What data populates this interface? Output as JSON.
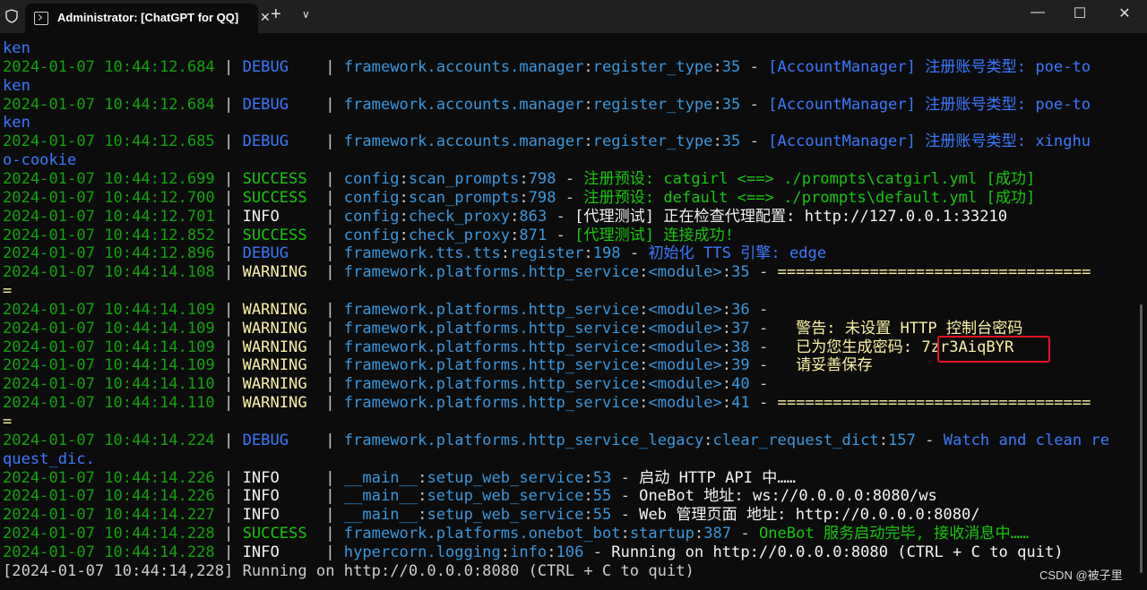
{
  "window": {
    "tab_title": "Administrator:  [ChatGPT for QQ]",
    "tab_close": "✕",
    "new_tab": "+",
    "dropdown": "∨",
    "minimize": "—",
    "maximize": "☐",
    "close": "✕"
  },
  "colors": {
    "background": "#0c0c0c",
    "timestamp_green": "#13a10e",
    "debug_blue": "#3b78ff",
    "module_cyan": "#3a96dd",
    "warning_yellow": "#f9f1a5",
    "success_green": "#16c60c",
    "highlight_box": "#e81123"
  },
  "lines": [
    [
      {
        "t": "ken",
        "c": "c-blue"
      }
    ],
    [
      {
        "t": "2024-01-07 10:44:12.684",
        "c": "c-green"
      },
      {
        "t": " | ",
        "c": "c-white"
      },
      {
        "t": "DEBUG   ",
        "c": "c-blue"
      },
      {
        "t": " | ",
        "c": "c-white"
      },
      {
        "t": "framework.accounts.manager",
        "c": "c-cyan"
      },
      {
        "t": ":",
        "c": "c-white"
      },
      {
        "t": "register_type",
        "c": "c-cyan"
      },
      {
        "t": ":",
        "c": "c-white"
      },
      {
        "t": "35",
        "c": "c-cyan"
      },
      {
        "t": " - ",
        "c": "c-white"
      },
      {
        "t": "[AccountManager] 注册账号类型: poe-to",
        "c": "c-blue"
      }
    ],
    [
      {
        "t": "ken",
        "c": "c-blue"
      }
    ],
    [
      {
        "t": "2024-01-07 10:44:12.684",
        "c": "c-green"
      },
      {
        "t": " | ",
        "c": "c-white"
      },
      {
        "t": "DEBUG   ",
        "c": "c-blue"
      },
      {
        "t": " | ",
        "c": "c-white"
      },
      {
        "t": "framework.accounts.manager",
        "c": "c-cyan"
      },
      {
        "t": ":",
        "c": "c-white"
      },
      {
        "t": "register_type",
        "c": "c-cyan"
      },
      {
        "t": ":",
        "c": "c-white"
      },
      {
        "t": "35",
        "c": "c-cyan"
      },
      {
        "t": " - ",
        "c": "c-white"
      },
      {
        "t": "[AccountManager] 注册账号类型: poe-to",
        "c": "c-blue"
      }
    ],
    [
      {
        "t": "ken",
        "c": "c-blue"
      }
    ],
    [
      {
        "t": "2024-01-07 10:44:12.685",
        "c": "c-green"
      },
      {
        "t": " | ",
        "c": "c-white"
      },
      {
        "t": "DEBUG   ",
        "c": "c-blue"
      },
      {
        "t": " | ",
        "c": "c-white"
      },
      {
        "t": "framework.accounts.manager",
        "c": "c-cyan"
      },
      {
        "t": ":",
        "c": "c-white"
      },
      {
        "t": "register_type",
        "c": "c-cyan"
      },
      {
        "t": ":",
        "c": "c-white"
      },
      {
        "t": "35",
        "c": "c-cyan"
      },
      {
        "t": " - ",
        "c": "c-white"
      },
      {
        "t": "[AccountManager] 注册账号类型: xinghu",
        "c": "c-blue"
      }
    ],
    [
      {
        "t": "o-cookie",
        "c": "c-blue"
      }
    ],
    [
      {
        "t": "2024-01-07 10:44:12.699",
        "c": "c-green"
      },
      {
        "t": " | ",
        "c": "c-white"
      },
      {
        "t": "SUCCESS ",
        "c": "c-lgreen"
      },
      {
        "t": " | ",
        "c": "c-white"
      },
      {
        "t": "config",
        "c": "c-cyan"
      },
      {
        "t": ":",
        "c": "c-white"
      },
      {
        "t": "scan_prompts",
        "c": "c-cyan"
      },
      {
        "t": ":",
        "c": "c-white"
      },
      {
        "t": "798",
        "c": "c-cyan"
      },
      {
        "t": " - ",
        "c": "c-white"
      },
      {
        "t": "注册预设: catgirl <==> ./prompts\\catgirl.yml [成功]",
        "c": "c-lgreen"
      }
    ],
    [
      {
        "t": "2024-01-07 10:44:12.700",
        "c": "c-green"
      },
      {
        "t": " | ",
        "c": "c-white"
      },
      {
        "t": "SUCCESS ",
        "c": "c-lgreen"
      },
      {
        "t": " | ",
        "c": "c-white"
      },
      {
        "t": "config",
        "c": "c-cyan"
      },
      {
        "t": ":",
        "c": "c-white"
      },
      {
        "t": "scan_prompts",
        "c": "c-cyan"
      },
      {
        "t": ":",
        "c": "c-white"
      },
      {
        "t": "798",
        "c": "c-cyan"
      },
      {
        "t": " - ",
        "c": "c-white"
      },
      {
        "t": "注册预设: default <==> ./prompts\\default.yml [成功]",
        "c": "c-lgreen"
      }
    ],
    [
      {
        "t": "2024-01-07 10:44:12.701",
        "c": "c-green"
      },
      {
        "t": " | ",
        "c": "c-white"
      },
      {
        "t": "INFO    ",
        "c": "c-brightwhite"
      },
      {
        "t": " | ",
        "c": "c-white"
      },
      {
        "t": "config",
        "c": "c-cyan"
      },
      {
        "t": ":",
        "c": "c-white"
      },
      {
        "t": "check_proxy",
        "c": "c-cyan"
      },
      {
        "t": ":",
        "c": "c-white"
      },
      {
        "t": "863",
        "c": "c-cyan"
      },
      {
        "t": " - ",
        "c": "c-white"
      },
      {
        "t": "[代理测试] 正在检查代理配置: http://127.0.0.1:33210",
        "c": "c-brightwhite"
      }
    ],
    [
      {
        "t": "2024-01-07 10:44:12.852",
        "c": "c-green"
      },
      {
        "t": " | ",
        "c": "c-white"
      },
      {
        "t": "SUCCESS ",
        "c": "c-lgreen"
      },
      {
        "t": " | ",
        "c": "c-white"
      },
      {
        "t": "config",
        "c": "c-cyan"
      },
      {
        "t": ":",
        "c": "c-white"
      },
      {
        "t": "check_proxy",
        "c": "c-cyan"
      },
      {
        "t": ":",
        "c": "c-white"
      },
      {
        "t": "871",
        "c": "c-cyan"
      },
      {
        "t": " - ",
        "c": "c-white"
      },
      {
        "t": "[代理测试] 连接成功!",
        "c": "c-lgreen"
      }
    ],
    [
      {
        "t": "2024-01-07 10:44:12.896",
        "c": "c-green"
      },
      {
        "t": " | ",
        "c": "c-white"
      },
      {
        "t": "DEBUG   ",
        "c": "c-blue"
      },
      {
        "t": " | ",
        "c": "c-white"
      },
      {
        "t": "framework.tts.tts",
        "c": "c-cyan"
      },
      {
        "t": ":",
        "c": "c-white"
      },
      {
        "t": "register",
        "c": "c-cyan"
      },
      {
        "t": ":",
        "c": "c-white"
      },
      {
        "t": "198",
        "c": "c-cyan"
      },
      {
        "t": " - ",
        "c": "c-white"
      },
      {
        "t": "初始化 TTS 引擎: edge",
        "c": "c-blue"
      }
    ],
    [
      {
        "t": "2024-01-07 10:44:14.108",
        "c": "c-green"
      },
      {
        "t": " | ",
        "c": "c-white"
      },
      {
        "t": "WARNING ",
        "c": "c-yellow"
      },
      {
        "t": " | ",
        "c": "c-white"
      },
      {
        "t": "framework.platforms.http_service",
        "c": "c-cyan"
      },
      {
        "t": ":",
        "c": "c-white"
      },
      {
        "t": "<module>",
        "c": "c-cyan"
      },
      {
        "t": ":",
        "c": "c-white"
      },
      {
        "t": "35",
        "c": "c-cyan"
      },
      {
        "t": " - ",
        "c": "c-white"
      },
      {
        "t": "==================================",
        "c": "c-yellow"
      }
    ],
    [
      {
        "t": "=",
        "c": "c-yellow"
      }
    ],
    [
      {
        "t": "2024-01-07 10:44:14.109",
        "c": "c-green"
      },
      {
        "t": " | ",
        "c": "c-white"
      },
      {
        "t": "WARNING ",
        "c": "c-yellow"
      },
      {
        "t": " | ",
        "c": "c-white"
      },
      {
        "t": "framework.platforms.http_service",
        "c": "c-cyan"
      },
      {
        "t": ":",
        "c": "c-white"
      },
      {
        "t": "<module>",
        "c": "c-cyan"
      },
      {
        "t": ":",
        "c": "c-white"
      },
      {
        "t": "36",
        "c": "c-cyan"
      },
      {
        "t": " - ",
        "c": "c-white"
      }
    ],
    [
      {
        "t": "2024-01-07 10:44:14.109",
        "c": "c-green"
      },
      {
        "t": " | ",
        "c": "c-white"
      },
      {
        "t": "WARNING ",
        "c": "c-yellow"
      },
      {
        "t": " | ",
        "c": "c-white"
      },
      {
        "t": "framework.platforms.http_service",
        "c": "c-cyan"
      },
      {
        "t": ":",
        "c": "c-white"
      },
      {
        "t": "<module>",
        "c": "c-cyan"
      },
      {
        "t": ":",
        "c": "c-white"
      },
      {
        "t": "37",
        "c": "c-cyan"
      },
      {
        "t": " - ",
        "c": "c-white"
      },
      {
        "t": "  警告: 未设置 HTTP 控制台密码",
        "c": "c-yellow"
      }
    ],
    [
      {
        "t": "2024-01-07 10:44:14.109",
        "c": "c-green"
      },
      {
        "t": " | ",
        "c": "c-white"
      },
      {
        "t": "WARNING ",
        "c": "c-yellow"
      },
      {
        "t": " | ",
        "c": "c-white"
      },
      {
        "t": "framework.platforms.http_service",
        "c": "c-cyan"
      },
      {
        "t": ":",
        "c": "c-white"
      },
      {
        "t": "<module>",
        "c": "c-cyan"
      },
      {
        "t": ":",
        "c": "c-white"
      },
      {
        "t": "38",
        "c": "c-cyan"
      },
      {
        "t": " - ",
        "c": "c-white"
      },
      {
        "t": "  已为您生成密码: 7zr3AiqBYR",
        "c": "c-yellow"
      }
    ],
    [
      {
        "t": "2024-01-07 10:44:14.109",
        "c": "c-green"
      },
      {
        "t": " | ",
        "c": "c-white"
      },
      {
        "t": "WARNING ",
        "c": "c-yellow"
      },
      {
        "t": " | ",
        "c": "c-white"
      },
      {
        "t": "framework.platforms.http_service",
        "c": "c-cyan"
      },
      {
        "t": ":",
        "c": "c-white"
      },
      {
        "t": "<module>",
        "c": "c-cyan"
      },
      {
        "t": ":",
        "c": "c-white"
      },
      {
        "t": "39",
        "c": "c-cyan"
      },
      {
        "t": " - ",
        "c": "c-white"
      },
      {
        "t": "  请妥善保存",
        "c": "c-yellow"
      }
    ],
    [
      {
        "t": "2024-01-07 10:44:14.110",
        "c": "c-green"
      },
      {
        "t": " | ",
        "c": "c-white"
      },
      {
        "t": "WARNING ",
        "c": "c-yellow"
      },
      {
        "t": " | ",
        "c": "c-white"
      },
      {
        "t": "framework.platforms.http_service",
        "c": "c-cyan"
      },
      {
        "t": ":",
        "c": "c-white"
      },
      {
        "t": "<module>",
        "c": "c-cyan"
      },
      {
        "t": ":",
        "c": "c-white"
      },
      {
        "t": "40",
        "c": "c-cyan"
      },
      {
        "t": " - ",
        "c": "c-white"
      }
    ],
    [
      {
        "t": "2024-01-07 10:44:14.110",
        "c": "c-green"
      },
      {
        "t": " | ",
        "c": "c-white"
      },
      {
        "t": "WARNING ",
        "c": "c-yellow"
      },
      {
        "t": " | ",
        "c": "c-white"
      },
      {
        "t": "framework.platforms.http_service",
        "c": "c-cyan"
      },
      {
        "t": ":",
        "c": "c-white"
      },
      {
        "t": "<module>",
        "c": "c-cyan"
      },
      {
        "t": ":",
        "c": "c-white"
      },
      {
        "t": "41",
        "c": "c-cyan"
      },
      {
        "t": " - ",
        "c": "c-white"
      },
      {
        "t": "==================================",
        "c": "c-yellow"
      }
    ],
    [
      {
        "t": "=",
        "c": "c-yellow"
      }
    ],
    [
      {
        "t": "2024-01-07 10:44:14.224",
        "c": "c-green"
      },
      {
        "t": " | ",
        "c": "c-white"
      },
      {
        "t": "DEBUG   ",
        "c": "c-blue"
      },
      {
        "t": " | ",
        "c": "c-white"
      },
      {
        "t": "framework.platforms.http_service_legacy",
        "c": "c-cyan"
      },
      {
        "t": ":",
        "c": "c-white"
      },
      {
        "t": "clear_request_dict",
        "c": "c-cyan"
      },
      {
        "t": ":",
        "c": "c-white"
      },
      {
        "t": "157",
        "c": "c-cyan"
      },
      {
        "t": " - ",
        "c": "c-white"
      },
      {
        "t": "Watch and clean re",
        "c": "c-blue"
      }
    ],
    [
      {
        "t": "quest_dic.",
        "c": "c-blue"
      }
    ],
    [
      {
        "t": "2024-01-07 10:44:14.226",
        "c": "c-green"
      },
      {
        "t": " | ",
        "c": "c-white"
      },
      {
        "t": "INFO    ",
        "c": "c-brightwhite"
      },
      {
        "t": " | ",
        "c": "c-white"
      },
      {
        "t": "__main__",
        "c": "c-cyan"
      },
      {
        "t": ":",
        "c": "c-white"
      },
      {
        "t": "setup_web_service",
        "c": "c-cyan"
      },
      {
        "t": ":",
        "c": "c-white"
      },
      {
        "t": "53",
        "c": "c-cyan"
      },
      {
        "t": " - ",
        "c": "c-white"
      },
      {
        "t": "启动 HTTP API 中……",
        "c": "c-brightwhite"
      }
    ],
    [
      {
        "t": "2024-01-07 10:44:14.226",
        "c": "c-green"
      },
      {
        "t": " | ",
        "c": "c-white"
      },
      {
        "t": "INFO    ",
        "c": "c-brightwhite"
      },
      {
        "t": " | ",
        "c": "c-white"
      },
      {
        "t": "__main__",
        "c": "c-cyan"
      },
      {
        "t": ":",
        "c": "c-white"
      },
      {
        "t": "setup_web_service",
        "c": "c-cyan"
      },
      {
        "t": ":",
        "c": "c-white"
      },
      {
        "t": "55",
        "c": "c-cyan"
      },
      {
        "t": " - ",
        "c": "c-white"
      },
      {
        "t": "OneBot 地址: ws://0.0.0.0:8080/ws",
        "c": "c-brightwhite"
      }
    ],
    [
      {
        "t": "2024-01-07 10:44:14.227",
        "c": "c-green"
      },
      {
        "t": " | ",
        "c": "c-white"
      },
      {
        "t": "INFO    ",
        "c": "c-brightwhite"
      },
      {
        "t": " | ",
        "c": "c-white"
      },
      {
        "t": "__main__",
        "c": "c-cyan"
      },
      {
        "t": ":",
        "c": "c-white"
      },
      {
        "t": "setup_web_service",
        "c": "c-cyan"
      },
      {
        "t": ":",
        "c": "c-white"
      },
      {
        "t": "55",
        "c": "c-cyan"
      },
      {
        "t": " - ",
        "c": "c-white"
      },
      {
        "t": "Web 管理页面 地址: http://0.0.0.0:8080/",
        "c": "c-brightwhite"
      }
    ],
    [
      {
        "t": "2024-01-07 10:44:14.228",
        "c": "c-green"
      },
      {
        "t": " | ",
        "c": "c-white"
      },
      {
        "t": "SUCCESS ",
        "c": "c-lgreen"
      },
      {
        "t": " | ",
        "c": "c-white"
      },
      {
        "t": "framework.platforms.onebot_bot",
        "c": "c-cyan"
      },
      {
        "t": ":",
        "c": "c-white"
      },
      {
        "t": "startup",
        "c": "c-cyan"
      },
      {
        "t": ":",
        "c": "c-white"
      },
      {
        "t": "387",
        "c": "c-cyan"
      },
      {
        "t": " - ",
        "c": "c-white"
      },
      {
        "t": "OneBot 服务启动完毕, 接收消息中……",
        "c": "c-lgreen"
      }
    ],
    [
      {
        "t": "2024-01-07 10:44:14.228",
        "c": "c-green"
      },
      {
        "t": " | ",
        "c": "c-white"
      },
      {
        "t": "INFO    ",
        "c": "c-brightwhite"
      },
      {
        "t": " | ",
        "c": "c-white"
      },
      {
        "t": "hypercorn.logging",
        "c": "c-cyan"
      },
      {
        "t": ":",
        "c": "c-white"
      },
      {
        "t": "info",
        "c": "c-cyan"
      },
      {
        "t": ":",
        "c": "c-white"
      },
      {
        "t": "106",
        "c": "c-cyan"
      },
      {
        "t": " - ",
        "c": "c-white"
      },
      {
        "t": "Running on http://0.0.0.0:8080 (CTRL + C to quit)",
        "c": "c-brightwhite"
      }
    ],
    [
      {
        "t": "[2024-01-07 10:44:14,228] Running on http://0.0.0.0:8080 (CTRL + C to quit)",
        "c": "c-white"
      }
    ]
  ],
  "watermark": "CSDN @被子里"
}
